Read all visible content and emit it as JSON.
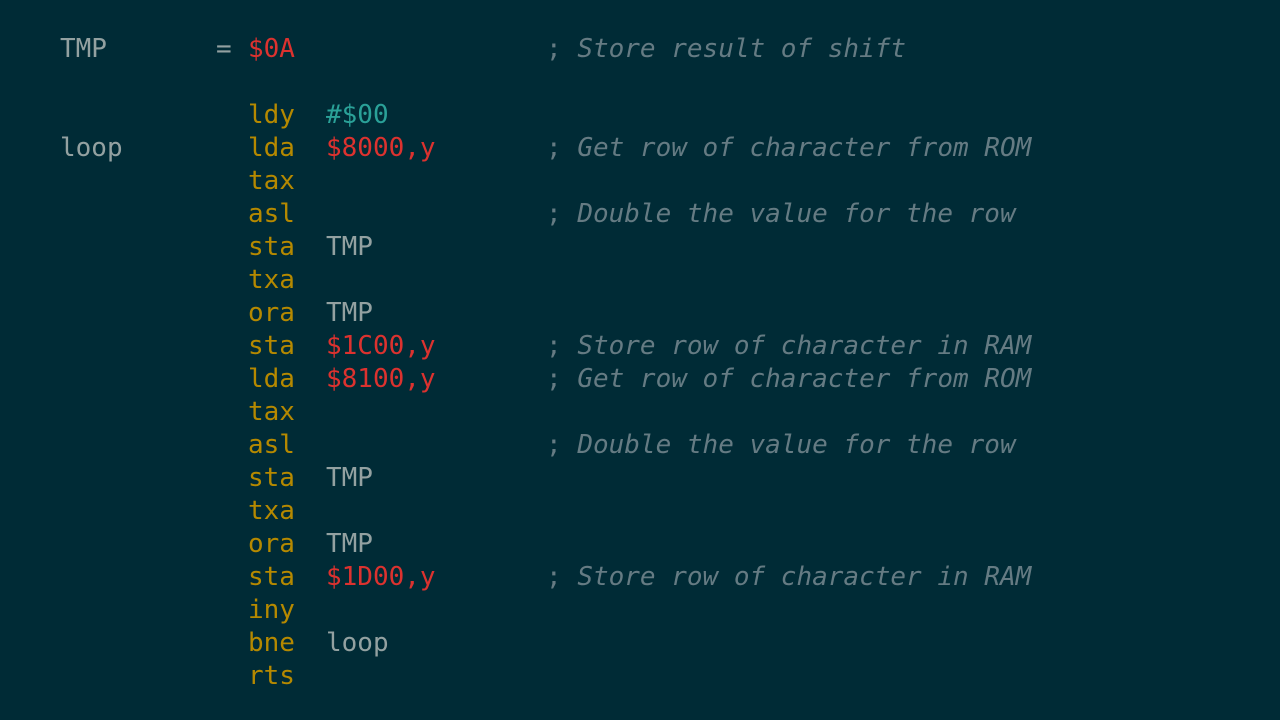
{
  "colors": {
    "background": "#002b36",
    "label": "#93a1a1",
    "mnemonic": "#b58900",
    "number": "#dc322f",
    "immediate": "#2aa198",
    "symbol": "#93a1a1",
    "comment": "#657b83",
    "punctuation": "#93a1a1"
  },
  "lines": [
    {
      "label": "TMP",
      "equals": "=",
      "operand": "$0A",
      "operand_kind": "number",
      "comment": "Store result of shift"
    },
    {
      "blank": true
    },
    {
      "mnemonic": "ldy",
      "operand": "#$00",
      "operand_kind": "immediate"
    },
    {
      "label": "loop",
      "mnemonic": "lda",
      "operand": "$8000,y",
      "operand_kind": "number",
      "comment": "Get row of character from ROM"
    },
    {
      "mnemonic": "tax"
    },
    {
      "mnemonic": "asl",
      "comment": "Double the value for the row"
    },
    {
      "mnemonic": "sta",
      "operand": "TMP",
      "operand_kind": "symbol"
    },
    {
      "mnemonic": "txa"
    },
    {
      "mnemonic": "ora",
      "operand": "TMP",
      "operand_kind": "symbol"
    },
    {
      "mnemonic": "sta",
      "operand": "$1C00,y",
      "operand_kind": "number",
      "comment": "Store row of character in RAM"
    },
    {
      "mnemonic": "lda",
      "operand": "$8100,y",
      "operand_kind": "number",
      "comment": "Get row of character from ROM"
    },
    {
      "mnemonic": "tax"
    },
    {
      "mnemonic": "asl",
      "comment": "Double the value for the row"
    },
    {
      "mnemonic": "sta",
      "operand": "TMP",
      "operand_kind": "symbol"
    },
    {
      "mnemonic": "txa"
    },
    {
      "mnemonic": "ora",
      "operand": "TMP",
      "operand_kind": "symbol"
    },
    {
      "mnemonic": "sta",
      "operand": "$1D00,y",
      "operand_kind": "number",
      "comment": "Store row of character in RAM"
    },
    {
      "mnemonic": "iny"
    },
    {
      "mnemonic": "bne",
      "operand": "loop",
      "operand_kind": "symbol"
    },
    {
      "mnemonic": "rts"
    }
  ]
}
